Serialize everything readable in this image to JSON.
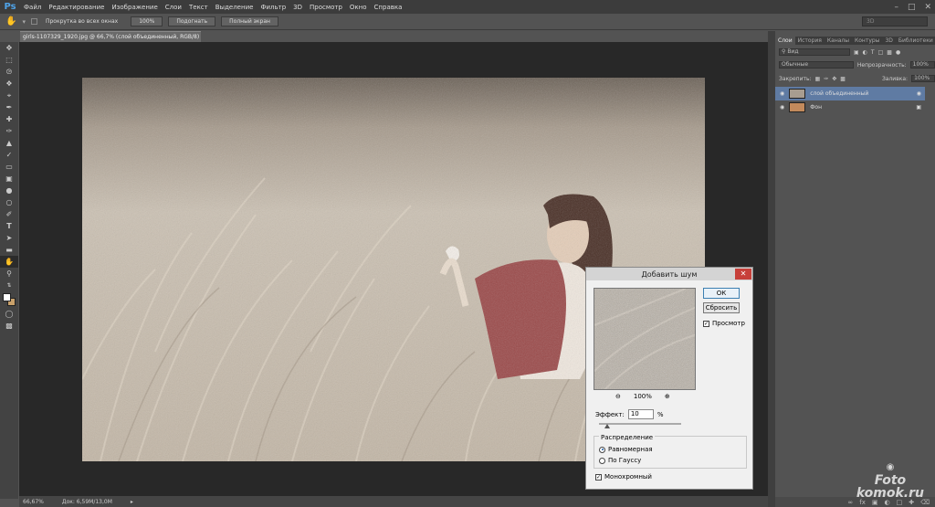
{
  "menubar": {
    "logo": "Ps",
    "items": [
      "Файл",
      "Редактирование",
      "Изображение",
      "Слои",
      "Текст",
      "Выделение",
      "Фильтр",
      "3D",
      "Просмотр",
      "Окно",
      "Справка"
    ]
  },
  "options": {
    "scroll_all_label": "Прокрутка во всех окнах",
    "zoom100": "100%",
    "fit": "Подогнать",
    "fullscreen": "Полный экран",
    "workspace": "3D"
  },
  "document": {
    "tab_title": "girls-1107329_1920.jpg @ 66,7% (слой объединенный, RGB/8) *"
  },
  "status": {
    "zoom": "66,67%",
    "doc": "Док: 6,59M/13,0M"
  },
  "panel": {
    "tabs": [
      "Слои",
      "История",
      "Каналы",
      "Контуры",
      "3D",
      "Библиотеки"
    ],
    "filter_label": "Вид",
    "blend_mode": "Обычные",
    "opacity_label": "Непрозрачность:",
    "opacity_value": "100%",
    "lock_label": "Закрепить:",
    "fill_label": "Заливка:",
    "fill_value": "100%",
    "layers": [
      {
        "name": "слой объединенный",
        "selected": true
      },
      {
        "name": "Фон",
        "selected": false
      }
    ]
  },
  "dialog": {
    "title": "Добавить шум",
    "ok": "ОК",
    "reset": "Сбросить",
    "preview_label": "Просмотр",
    "zoom_value": "100%",
    "amount_label": "Эффект:",
    "amount_value": "10",
    "amount_unit": "%",
    "distribution_label": "Распределение",
    "uniform_label": "Равномерная",
    "gaussian_label": "По Гауссу",
    "mono_label": "Монохромный",
    "amount_slider_fraction": 0.1
  },
  "watermark": {
    "line1": "Foto",
    "line2": "komok.ru"
  },
  "colors": {
    "accent": "#4fa3e8",
    "close": "#c7403a"
  }
}
